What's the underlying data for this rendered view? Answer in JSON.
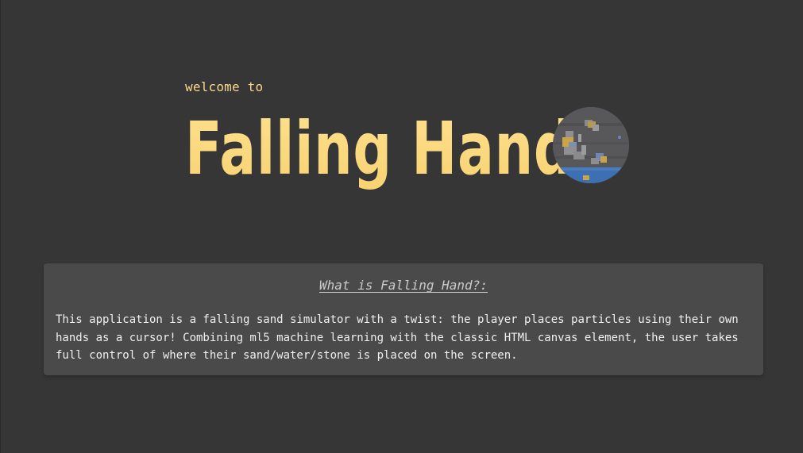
{
  "header": {
    "welcome_text": "welcome to",
    "app_title": "Falling Hand",
    "logo_icon": "falling-sand-hand-logo-icon"
  },
  "about": {
    "heading": "What is Falling Hand?:",
    "description": "This application is a falling sand simulator with a twist: the player places particles using their own hands as a cursor! Combining ml5 machine learning with the classic HTML canvas element, the user takes full control of where their sand/water/stone is placed on the screen."
  },
  "colors": {
    "background": "#363636",
    "title_yellow": "#fbd774",
    "card_background": "#4a4a4a",
    "card_heading": "#c9c9c9",
    "body_text": "#f0f0f0"
  }
}
